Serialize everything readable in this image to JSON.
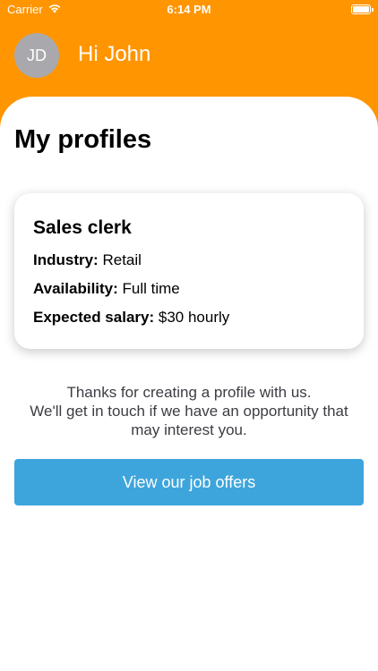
{
  "status_bar": {
    "carrier": "Carrier",
    "time": "6:14 PM",
    "wifi_icon": "wifi-icon",
    "battery_icon": "battery-icon",
    "battery_level": 1.0
  },
  "header": {
    "avatar_initials": "JD",
    "greeting": "Hi John",
    "background_color": "#FF9500"
  },
  "main": {
    "title": "My profiles",
    "profiles": [
      {
        "title": "Sales clerk",
        "industry_label": "Industry:",
        "industry_value": "Retail",
        "availability_label": "Availability:",
        "availability_value": "Full time",
        "salary_label": "Expected salary:",
        "salary_value": "$30 hourly"
      }
    ],
    "thanks_lines": [
      "Thanks for creating a profile with us.",
      "We'll get in touch if we have an opportunity that",
      "may interest you."
    ],
    "cta_label": "View our job offers",
    "cta_color": "#3DA5DC"
  }
}
